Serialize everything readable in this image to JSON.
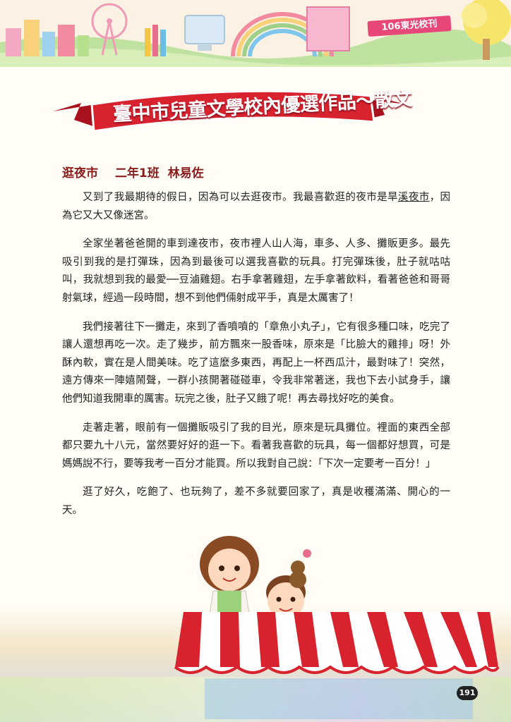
{
  "header": {
    "issue_tag": "106東光校刊"
  },
  "banner": {
    "title": "臺中市兒童文學校內優選作品～散文"
  },
  "article": {
    "title": "逛夜市",
    "class": "二年1班",
    "author": "林易佐",
    "paragraphs": [
      {
        "before": "又到了我最期待的假日，因為可以去逛夜市。我最喜歡逛的夜市是旱",
        "underlined": "溪夜市",
        "after": "，因為它又大又像迷宮。"
      },
      {
        "text": "全家坐著爸爸開的車到達夜市，夜市裡人山人海，車多、人多、攤販更多。最先吸引到我的是打彈珠，因為到最後可以選我喜歡的玩具。打完彈珠後，肚子就咕咕叫，我就想到我的最愛──豆滷雞翅。右手拿著雞翅，左手拿著飲料，看著爸爸和哥哥射氣球，經過一段時間，想不到他們倆射成平手，真是太厲害了！"
      },
      {
        "text": "我們接著往下一攤走，來到了香噴噴的「章魚小丸子」，它有很多種口味，吃完了讓人還想再吃一次。走了幾步，前方飄來一股香味，原來是「比臉大的雞排」呀！外酥內軟，實在是人間美味。吃了這麼多東西，再配上一杯西瓜汁，最對味了！突然，遠方傳來一陣嬉鬧聲，一群小孩開著碰碰車，令我非常著迷，我也下去小試身手，讓他們知道我開車的厲害。玩完之後，肚子又餓了呢！再去尋找好吃的美食。"
      },
      {
        "text": "走著走著，眼前有一個攤販吸引了我的目光，原來是玩具攤位。裡面的東西全部都只要九十八元，當然要好好的逛一下。看著我喜歡的玩具，每一個都好想買，可是媽媽說不行，要等我考一百分才能買。所以我對自己說：「下次一定要考一百分！」"
      },
      {
        "text": "逛了好久，吃飽了、也玩夠了，差不多就要回家了，真是收穫滿滿、開心的一天。"
      }
    ]
  },
  "page_number": "191",
  "colors": {
    "banner_red": "#d8232f",
    "heading": "#8b1c1c",
    "tag_pink": "#e8477a"
  }
}
